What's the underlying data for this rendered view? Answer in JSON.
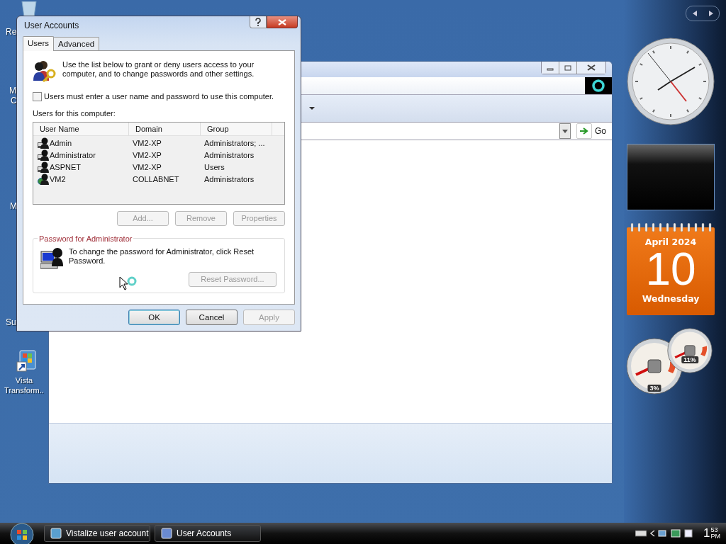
{
  "desktop": {
    "icons": [
      {
        "label": "Re"
      },
      {
        "label": "M"
      },
      {
        "label": "C"
      },
      {
        "label": "M"
      },
      {
        "label": "Su"
      },
      {
        "label": "Vista Transform.."
      }
    ]
  },
  "background_window": {
    "go_button": "Go"
  },
  "dialog": {
    "title": "User Accounts",
    "tabs": [
      {
        "label": "Users",
        "selected": true
      },
      {
        "label": "Advanced",
        "selected": false
      }
    ],
    "intro": "Use the list below to grant or deny users access to your computer, and to change passwords and other settings.",
    "require_password": {
      "label": "Users must enter a user name and password to use this computer.",
      "checked": false
    },
    "users_label": "Users for this computer:",
    "columns": [
      "User Name",
      "Domain",
      "Group"
    ],
    "rows": [
      {
        "kind": "local",
        "cells": [
          "Admin",
          "VM2-XP",
          "Administrators; ..."
        ]
      },
      {
        "kind": "local",
        "cells": [
          "Administrator",
          "VM2-XP",
          "Administrators"
        ]
      },
      {
        "kind": "local",
        "cells": [
          "ASPNET",
          "VM2-XP",
          "Users"
        ]
      },
      {
        "kind": "domain",
        "cells": [
          "VM2",
          "COLLABNET",
          "Administrators"
        ]
      }
    ],
    "list_buttons": [
      {
        "label": "Add...",
        "disabled": true
      },
      {
        "label": "Remove",
        "disabled": true
      },
      {
        "label": "Properties",
        "disabled": true
      }
    ],
    "password_group": {
      "title": "Password for Administrator",
      "text": "To change the password for Administrator, click Reset Password.",
      "button": {
        "label": "Reset Password...",
        "disabled": true
      }
    },
    "buttons": [
      {
        "label": "OK",
        "disabled": false
      },
      {
        "label": "Cancel",
        "disabled": false
      },
      {
        "label": "Apply",
        "disabled": true
      }
    ]
  },
  "gadgets": {
    "calendar": {
      "month": "April 2024",
      "day": "10",
      "weekday": "Wednesday"
    },
    "meters": [
      {
        "reading": "3%"
      },
      {
        "reading": "11%"
      }
    ]
  },
  "taskbar": {
    "tasks": [
      {
        "label": "Vistalize user account"
      },
      {
        "label": "User Accounts"
      }
    ],
    "clock": {
      "hour": "1",
      "minutes": "53",
      "period": "PM"
    }
  }
}
